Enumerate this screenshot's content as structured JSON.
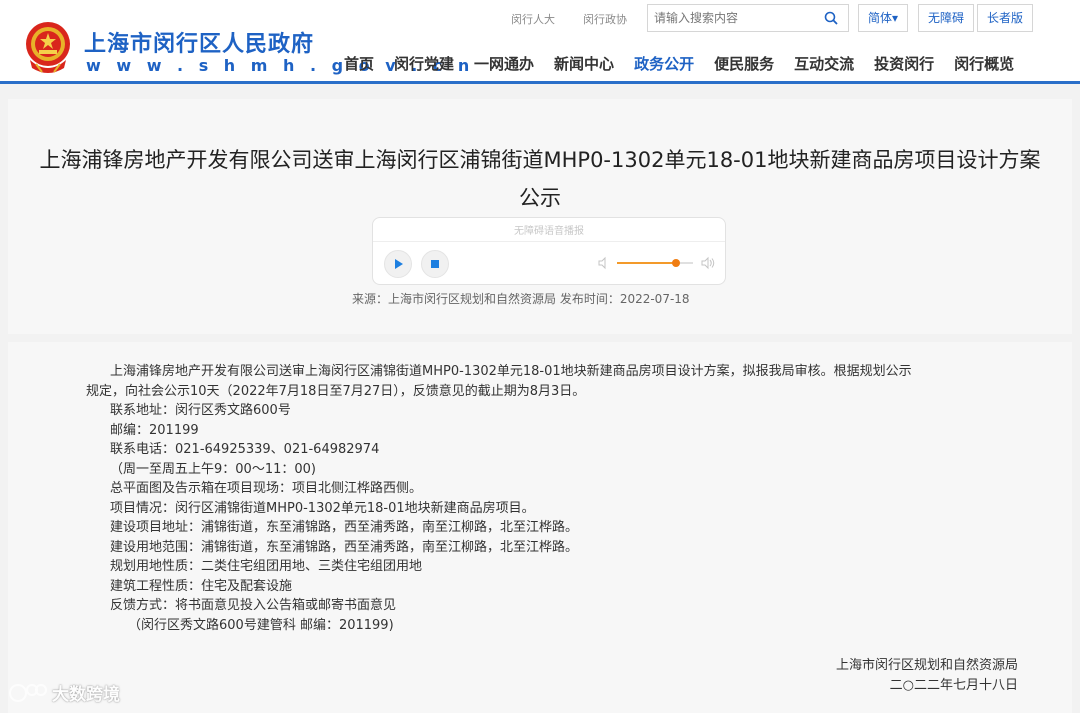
{
  "header": {
    "site_title": "上海市闵行区人民政府",
    "site_url": "w w w . s h m h . g o v . c n",
    "util_links": [
      "闵行人大",
      "闵行政协"
    ],
    "search_placeholder": "请输入搜索内容",
    "lang_button": "简体▾",
    "accessibility_button": "无障碍",
    "elder_button": "长者版",
    "nav": [
      "首页",
      "闵行党建",
      "一网通办",
      "新闻中心",
      "政务公开",
      "便民服务",
      "互动交流",
      "投资闵行",
      "闵行概览"
    ],
    "active_nav": "政务公开",
    "accent_color": "#1e62c4"
  },
  "article": {
    "title": "上海浦锋房地产开发有限公司送审上海闵行区浦锦街道MHP0-1302单元18-01地块新建商品房项目设计方案公示",
    "audio_label": "无障碍语音播报",
    "audio_volume": 0.78,
    "source_line": "来源：上海市闵行区规划和自然资源局 发布时间：2022-07-18",
    "paragraph": [
      "上海浦锋房地产开发有限公司送审上海闵行区浦锦街道MHP0-1302单元18-01地块新建商品房项目设计方案，拟报我局审核。根据规划公示",
      "规定，向社会公示10天（2022年7月18日至7月27日），反馈意见的截止期为8月3日。"
    ],
    "lines": [
      "联系地址：闵行区秀文路600号",
      "邮编：201199",
      "联系电话：021-64925339、021-64982974",
      "（周一至周五上午9：00～11：00)",
      "总平面图及告示箱在项目现场：项目北侧江桦路西侧。",
      "项目情况：闵行区浦锦街道MHP0-1302单元18-01地块新建商品房项目。",
      "建设项目地址：浦锦街道，东至浦锦路，西至浦秀路，南至江柳路，北至江桦路。",
      "建设用地范围：浦锦街道，东至浦锦路，西至浦秀路，南至江柳路，北至江桦路。",
      "规划用地性质：二类住宅组团用地、三类住宅组团用地",
      "建筑工程性质：住宅及配套设施",
      "反馈方式：将书面意见投入公告箱或邮寄书面意见",
      "（闵行区秀文路600号建管科  邮编：201199)"
    ],
    "signature_org": "上海市闵行区规划和自然资源局",
    "signature_date": "二○二二年七月十八日"
  },
  "watermark": "大数跨境"
}
